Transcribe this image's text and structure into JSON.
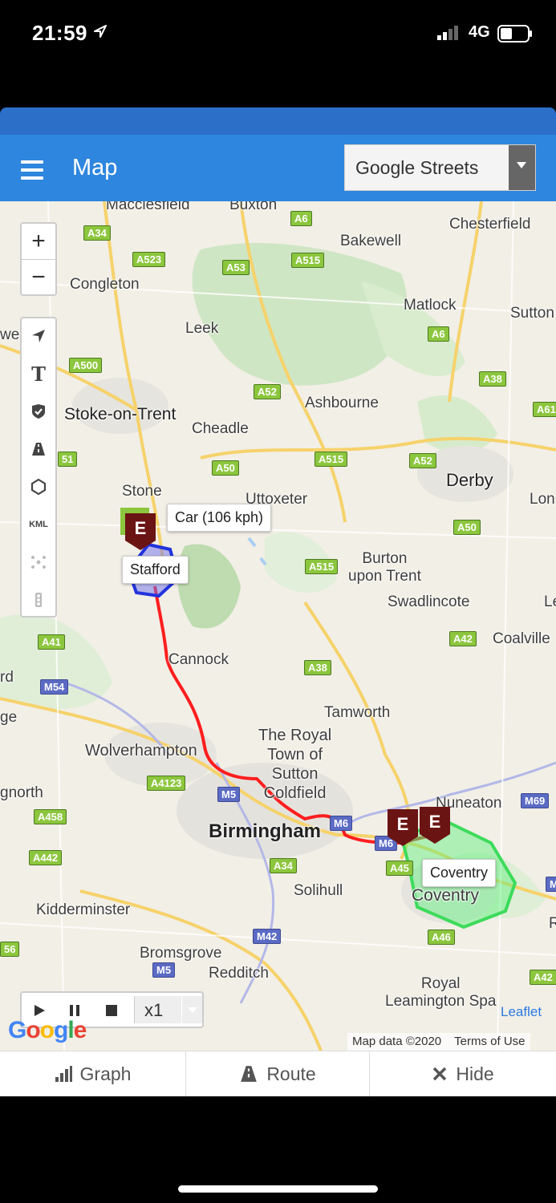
{
  "status_bar": {
    "time": "21:59",
    "network": "4G"
  },
  "header": {
    "title": "Map",
    "layer_select": {
      "selected": "Google Streets"
    }
  },
  "map": {
    "places": [
      {
        "id": "macclesfield",
        "text": "Macclesfield"
      },
      {
        "id": "buxton",
        "text": "Buxton"
      },
      {
        "id": "chesterfield",
        "text": "Chesterfield"
      },
      {
        "id": "bakewell",
        "text": "Bakewell"
      },
      {
        "id": "congleton",
        "text": "Congleton"
      },
      {
        "id": "matlock",
        "text": "Matlock"
      },
      {
        "id": "sutton",
        "text": "Sutton"
      },
      {
        "id": "leek",
        "text": "Leek"
      },
      {
        "id": "we",
        "text": "we"
      },
      {
        "id": "ashbourne",
        "text": "Ashbourne"
      },
      {
        "id": "stoke",
        "text": "Stoke-on-Trent"
      },
      {
        "id": "cheadle",
        "text": "Cheadle"
      },
      {
        "id": "derby",
        "text": "Derby"
      },
      {
        "id": "lon",
        "text": "Lon"
      },
      {
        "id": "stone",
        "text": "Stone"
      },
      {
        "id": "uttoxeter",
        "text": "Uttoxeter"
      },
      {
        "id": "burton",
        "text": "Burton\nupon Trent"
      },
      {
        "id": "swadlincote",
        "text": "Swadlincote"
      },
      {
        "id": "le",
        "text": "Le"
      },
      {
        "id": "coalville",
        "text": "Coalville"
      },
      {
        "id": "cannock",
        "text": "Cannock"
      },
      {
        "id": "rd",
        "text": "rd"
      },
      {
        "id": "ge",
        "text": "ge"
      },
      {
        "id": "tamworth",
        "text": "Tamworth"
      },
      {
        "id": "royal_town",
        "text": "The Royal\nTown of\nSutton\nColdfield"
      },
      {
        "id": "wolverhampton",
        "text": "Wolverhampton"
      },
      {
        "id": "gnorth",
        "text": "gnorth"
      },
      {
        "id": "nuneaton",
        "text": "Nuneaton"
      },
      {
        "id": "birmingham",
        "text": "Birmingham"
      },
      {
        "id": "solihull",
        "text": "Solihull"
      },
      {
        "id": "coventry_map",
        "text": "Coventry"
      },
      {
        "id": "kidderminster",
        "text": "Kidderminster"
      },
      {
        "id": "r",
        "text": "R"
      },
      {
        "id": "bromsgrove",
        "text": "Bromsgrove"
      },
      {
        "id": "redditch",
        "text": "Redditch"
      },
      {
        "id": "royal_leamington",
        "text": "Royal\nLeamington Spa"
      }
    ],
    "roads": [
      {
        "id": "a34_n",
        "text": "A34"
      },
      {
        "id": "a6_n",
        "text": "A6"
      },
      {
        "id": "a523",
        "text": "A523"
      },
      {
        "id": "a53",
        "text": "A53"
      },
      {
        "id": "a515_n",
        "text": "A515"
      },
      {
        "id": "a6_s",
        "text": "A6"
      },
      {
        "id": "a500",
        "text": "A500"
      },
      {
        "id": "a52_w",
        "text": "A52"
      },
      {
        "id": "a38_n",
        "text": "A38"
      },
      {
        "id": "a61",
        "text": "A61"
      },
      {
        "id": "a50_w",
        "text": "A50"
      },
      {
        "id": "a515_m",
        "text": "A515"
      },
      {
        "id": "a52_e",
        "text": "A52"
      },
      {
        "id": "a50_e",
        "text": "A50"
      },
      {
        "id": "a515_s",
        "text": "A515"
      },
      {
        "id": "a41",
        "text": "A41"
      },
      {
        "id": "a42",
        "text": "A42"
      },
      {
        "id": "m54",
        "text": "M54"
      },
      {
        "id": "a38_s",
        "text": "A38"
      },
      {
        "id": "a4123",
        "text": "A4123"
      },
      {
        "id": "m5_n",
        "text": "M5"
      },
      {
        "id": "m69",
        "text": "M69"
      },
      {
        "id": "a458",
        "text": "A458"
      },
      {
        "id": "m6",
        "text": "M6"
      },
      {
        "id": "m6_2",
        "text": "M6"
      },
      {
        "id": "a442",
        "text": "A442"
      },
      {
        "id": "a34_s",
        "text": "A34"
      },
      {
        "id": "a45",
        "text": "A45"
      },
      {
        "id": "a46",
        "text": "A46"
      },
      {
        "id": "m42",
        "text": "M42"
      },
      {
        "id": "m5_s",
        "text": "M5"
      },
      {
        "id": "a42_r",
        "text": "A42"
      },
      {
        "id": "edge56",
        "text": "56"
      },
      {
        "id": "edge51",
        "text": "51"
      },
      {
        "id": "edgem",
        "text": "M"
      }
    ],
    "tooltips": {
      "car": "Car (106 kph)",
      "stafford": "Stafford",
      "coventry": "Coventry"
    },
    "markers": [
      {
        "id": "m1",
        "label": "E"
      },
      {
        "id": "m2",
        "label": "E"
      },
      {
        "id": "m3",
        "label": "E"
      }
    ],
    "tools": {
      "kml": "KML",
      "text": "T"
    },
    "playback": {
      "speed": "x1"
    },
    "attribution": {
      "leaflet": "Leaflet",
      "data": "Map data ©2020",
      "terms": "Terms of Use",
      "google": "Google"
    }
  },
  "bottom_tabs": [
    {
      "label": "Graph"
    },
    {
      "label": "Route"
    },
    {
      "label": "Hide"
    }
  ],
  "colors": {
    "appbar": "#2e86de",
    "route": "#ff1e1e",
    "geofence_green": "#59f07a",
    "geofence_blue": "#2233dd",
    "marker": "#6b1414"
  }
}
